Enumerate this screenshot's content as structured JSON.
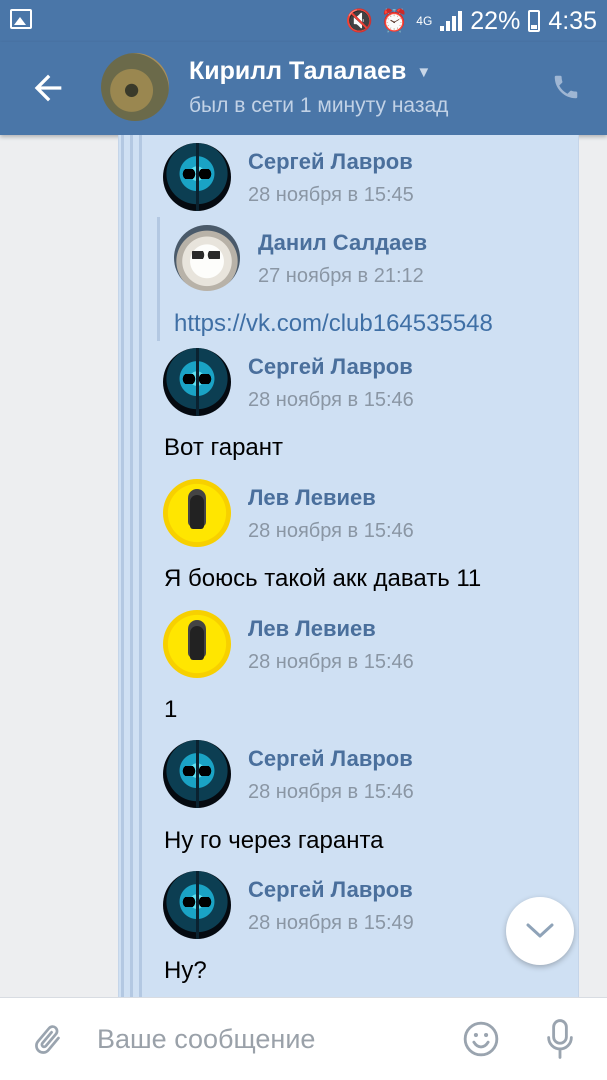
{
  "status_bar": {
    "network": "4G",
    "battery_percent": "22%",
    "battery_level": 0.22,
    "time": "4:35"
  },
  "header": {
    "title": "Кирилл Талалаев",
    "subtitle": "был в сети 1 минуту назад"
  },
  "chat": {
    "forwarded": [
      {
        "sender": "Сергей Лавров",
        "date": "28 ноября в 15:45",
        "avatar": "skull-avatar"
      },
      {
        "sender": "Данил Салдаев",
        "date": "27 ноября в 21:12",
        "avatar": "cat-avatar",
        "link": "https://vk.com/club164535548"
      },
      {
        "sender": "Сергей Лавров",
        "date": "28 ноября в 15:46",
        "avatar": "skull-avatar",
        "text": "Вот гарант"
      },
      {
        "sender": "Лев Левиев",
        "date": "28 ноября в 15:46",
        "avatar": "yellow-avatar",
        "text": "Я боюсь такой акк давать 11"
      },
      {
        "sender": "Лев Левиев",
        "date": "28 ноября в 15:46",
        "avatar": "yellow-avatar",
        "text": "1"
      },
      {
        "sender": "Сергей Лавров",
        "date": "28 ноября в 15:46",
        "avatar": "skull-avatar",
        "text": "Ну го через гаранта"
      },
      {
        "sender": "Сергей Лавров",
        "date": "28 ноября в 15:49",
        "avatar": "skull-avatar",
        "text": "Ну?"
      }
    ]
  },
  "composer": {
    "placeholder": "Ваше сообщение"
  },
  "colors": {
    "header_bg": "#4a76a8",
    "bubble_bg": "#cfe0f3",
    "name_color": "#4a6f9c",
    "link_color": "#3f6fa5"
  }
}
